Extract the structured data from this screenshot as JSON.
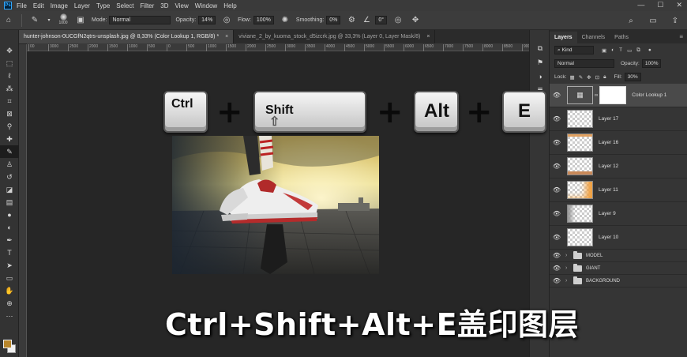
{
  "menubar": {
    "logo": "Ps",
    "items": [
      "File",
      "Edit",
      "Image",
      "Layer",
      "Type",
      "Select",
      "Filter",
      "3D",
      "View",
      "Window",
      "Help"
    ]
  },
  "options": {
    "brush_size": "1000",
    "mode_label": "Mode:",
    "mode_value": "Normal",
    "opacity_label": "Opacity:",
    "opacity_value": "14%",
    "flow_label": "Flow:",
    "flow_value": "100%",
    "smoothing_label": "Smoothing:",
    "smoothing_value": "0%",
    "angle_value": "0°"
  },
  "tabs": [
    {
      "label": "hunter-johnson-0UCGfN2qtrs-unsplash.jpg @ 8,33% (Color Lookup 1, RGB/8) *",
      "close": "×"
    },
    {
      "label": "viviane_2_by_kuoma_stock_d5izcrk.jpg @ 33,3% (Layer 0, Layer Mask/8)",
      "close": "×"
    }
  ],
  "ruler": [
    "00",
    "3000",
    "2500",
    "2000",
    "1500",
    "1000",
    "500",
    "0",
    "500",
    "1000",
    "1500",
    "2000",
    "2500",
    "3000",
    "3500",
    "4000",
    "4500",
    "5000",
    "5500",
    "6000",
    "6500",
    "7000",
    "7500",
    "8000",
    "8500",
    "9000"
  ],
  "keys": {
    "ctrl": "Ctrl",
    "shift": "Shift",
    "alt": "Alt",
    "e": "E",
    "plus": "+"
  },
  "caption": "Ctrl+Shift+Alt+E盖印图层",
  "layers_panel": {
    "tabs": [
      "Layers",
      "Channels",
      "Paths"
    ],
    "kind": "Kind",
    "blend_mode": "Normal",
    "opacity_label": "Opacity:",
    "opacity_value": "100%",
    "lock_label": "Lock:",
    "fill_label": "Fill:",
    "fill_value": "30%",
    "layers": [
      {
        "name": "Color Lookup 1"
      },
      {
        "name": "Layer 17"
      },
      {
        "name": "Layer 16"
      },
      {
        "name": "Layer 12"
      },
      {
        "name": "Layer 11"
      },
      {
        "name": "Layer 9"
      },
      {
        "name": "Layer 10"
      }
    ],
    "groups": [
      {
        "name": "MODEL"
      },
      {
        "name": "GIANT"
      },
      {
        "name": "BACKGROUND"
      }
    ]
  },
  "colors": {
    "foreground": "#b8862b",
    "background": "#f0f0f0"
  }
}
